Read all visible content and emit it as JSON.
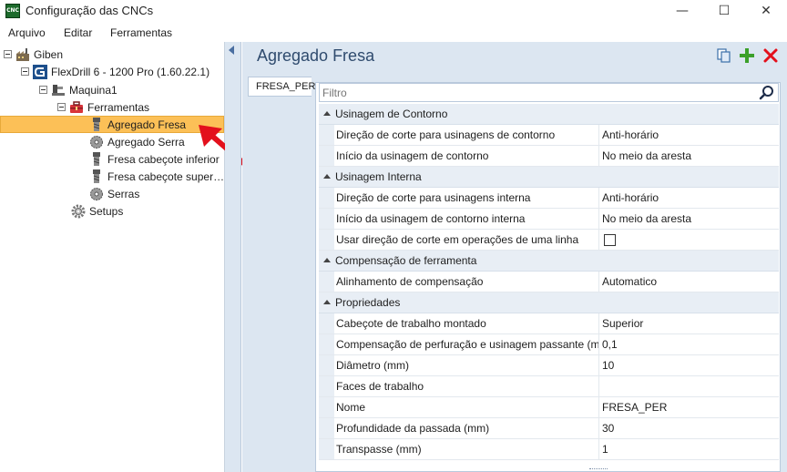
{
  "window": {
    "title": "Configuração das CNCs",
    "app_icon": "CNC",
    "controls": {
      "minimize": "—",
      "maximize": "☐",
      "close": "✕"
    }
  },
  "menu": [
    "Arquivo",
    "Editar",
    "Ferramentas"
  ],
  "tree": {
    "root": "Giben",
    "machine": "FlexDrill 6 - 1200 Pro (1.60.22.1)",
    "maquina": "Maquina1",
    "ferramentas": "Ferramentas",
    "tools": [
      "Agregado Fresa",
      "Agregado Serra",
      "Fresa cabeçote inferior",
      "Fresa cabeçote super…",
      "Serras"
    ],
    "setups": "Setups"
  },
  "panel": {
    "title": "Agregado Fresa",
    "tab": "FRESA_PER",
    "filter_placeholder": "Filtro"
  },
  "grid": {
    "categories": [
      {
        "name": "Usinagem de Contorno",
        "props": [
          {
            "name": "Direção de corte para usinagens de contorno",
            "value": "Anti-horário"
          },
          {
            "name": "Início da usinagem de contorno",
            "value": "No meio da aresta"
          }
        ]
      },
      {
        "name": "Usinagem Interna",
        "props": [
          {
            "name": "Direção de corte para usinagens interna",
            "value": "Anti-horário"
          },
          {
            "name": "Início da usinagem de contorno interna",
            "value": "No meio da aresta"
          },
          {
            "name": "Usar direção de corte em operações de uma linha",
            "value": "",
            "checkbox": true
          }
        ]
      },
      {
        "name": "Compensação de ferramenta",
        "props": [
          {
            "name": "Alinhamento de compensação",
            "value": "Automatico"
          }
        ]
      },
      {
        "name": "Propriedades",
        "props": [
          {
            "name": "Cabeçote de trabalho montado",
            "value": "Superior"
          },
          {
            "name": "Compensação de perfuração e usinagem passante (mm)",
            "value": "0,1"
          },
          {
            "name": "Diâmetro (mm)",
            "value": "10"
          },
          {
            "name": "Faces de trabalho",
            "value": ""
          },
          {
            "name": "Nome",
            "value": "FRESA_PER"
          },
          {
            "name": "Profundidade da passada (mm)",
            "value": "30"
          },
          {
            "name": "Transpasse (mm)",
            "value": "1"
          }
        ]
      }
    ]
  },
  "colors": {
    "accent_panel": "#dce6f1",
    "selection": "#fcc057",
    "title_text": "#2f4b6e",
    "annotation_arrow": "#e3101c"
  }
}
